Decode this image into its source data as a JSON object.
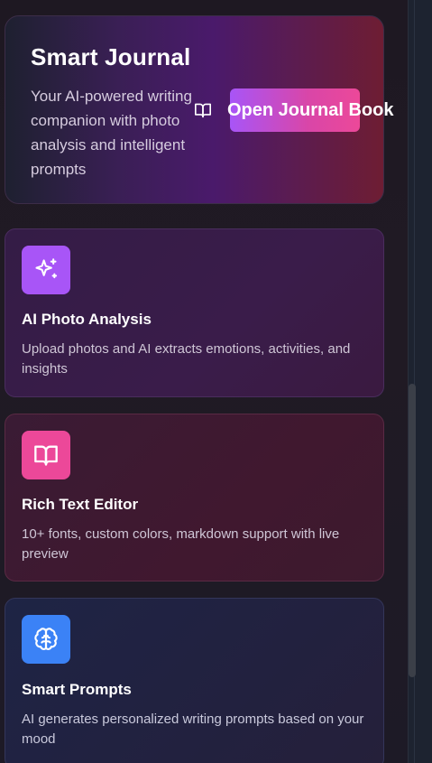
{
  "hero": {
    "title": "Smart Journal",
    "description": "Your AI-powered writing companion with photo analysis and intelligent prompts",
    "button_label": "Open Journal Book",
    "button_icon": "book-open-icon"
  },
  "features": [
    {
      "icon": "sparkles-icon",
      "icon_color": "#a855f7",
      "title": "AI Photo Analysis",
      "description": "Upload photos and AI extracts emotions, activities, and insights"
    },
    {
      "icon": "book-open-icon",
      "icon_color": "#ec4899",
      "title": "Rich Text Editor",
      "description": "10+ fonts, custom colors, markdown support with live preview"
    },
    {
      "icon": "brain-icon",
      "icon_color": "#3b82f6",
      "title": "Smart Prompts",
      "description": "AI generates personalized writing prompts based on your mood"
    }
  ],
  "colors": {
    "accent_purple": "#a855f7",
    "accent_pink": "#ec4899",
    "accent_blue": "#3b82f6"
  }
}
